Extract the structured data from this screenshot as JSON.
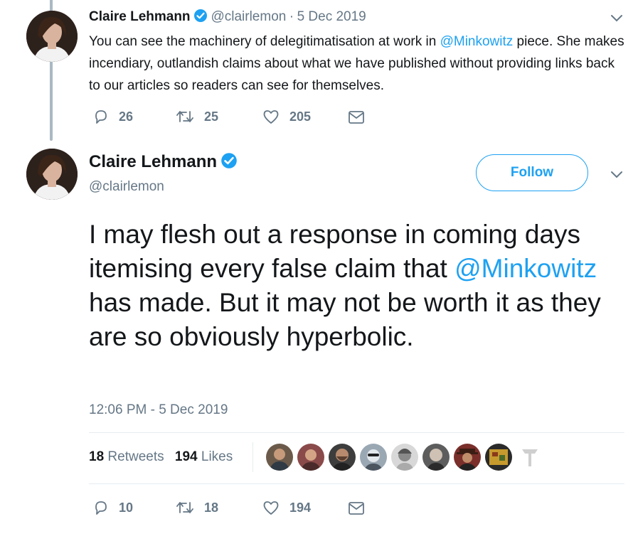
{
  "parent_tweet": {
    "author_name": "Claire Lehmann",
    "handle": "@clairlemon",
    "separator": "·",
    "date": "5 Dec 2019",
    "text_before": "You can see the machinery of delegitimatisation at work in ",
    "mention": "@Minkowitz",
    "text_after": " piece. She makes incendiary, outlandish claims about what we have published without providing links back to our articles so readers can see for themselves.",
    "actions": {
      "replies": "26",
      "retweets": "25",
      "likes": "205"
    }
  },
  "main_tweet": {
    "author_name": "Claire Lehmann",
    "handle": "@clairlemon",
    "follow_label": "Follow",
    "text_before": "I may flesh out a response in coming days itemising every false claim that ",
    "mention": "@Minkowitz",
    "text_after": " has made. But it may not be worth it as they are so obviously hyperbolic.",
    "timestamp": "12:06 PM - 5 Dec 2019",
    "stats": {
      "retweets_count": "18",
      "retweets_label": "Retweets",
      "likes_count": "194",
      "likes_label": "Likes"
    },
    "actions": {
      "replies": "10",
      "retweets": "18",
      "likes": "194"
    }
  },
  "colors": {
    "brand": "#1da1f2",
    "text": "#14171a",
    "muted": "#657786",
    "divider": "#e6ecf0"
  },
  "icons": [
    "verified-badge-icon",
    "chevron-down-icon",
    "reply-icon",
    "retweet-icon",
    "like-icon",
    "direct-message-icon"
  ]
}
